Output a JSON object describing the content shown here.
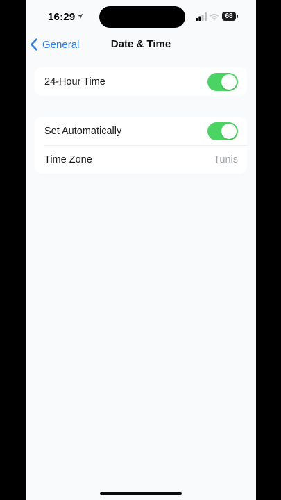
{
  "status_bar": {
    "time": "16:29",
    "battery": "68",
    "icons": [
      "location-icon",
      "signal-icon",
      "wifi-icon",
      "battery-icon"
    ]
  },
  "nav": {
    "back_label": "General",
    "title": "Date & Time",
    "back_icon": "chevron-left-icon"
  },
  "groups": [
    {
      "rows": [
        {
          "label": "24-Hour Time",
          "toggle": "on"
        }
      ]
    },
    {
      "rows": [
        {
          "label": "Set Automatically",
          "toggle": "on"
        },
        {
          "label": "Time Zone",
          "value": "Tunis"
        }
      ]
    }
  ],
  "colors": {
    "accent": "#2f7ee0",
    "toggle_on": "#4bd464",
    "background": "#f9fafc",
    "secondary_text": "#9fa3a9"
  }
}
